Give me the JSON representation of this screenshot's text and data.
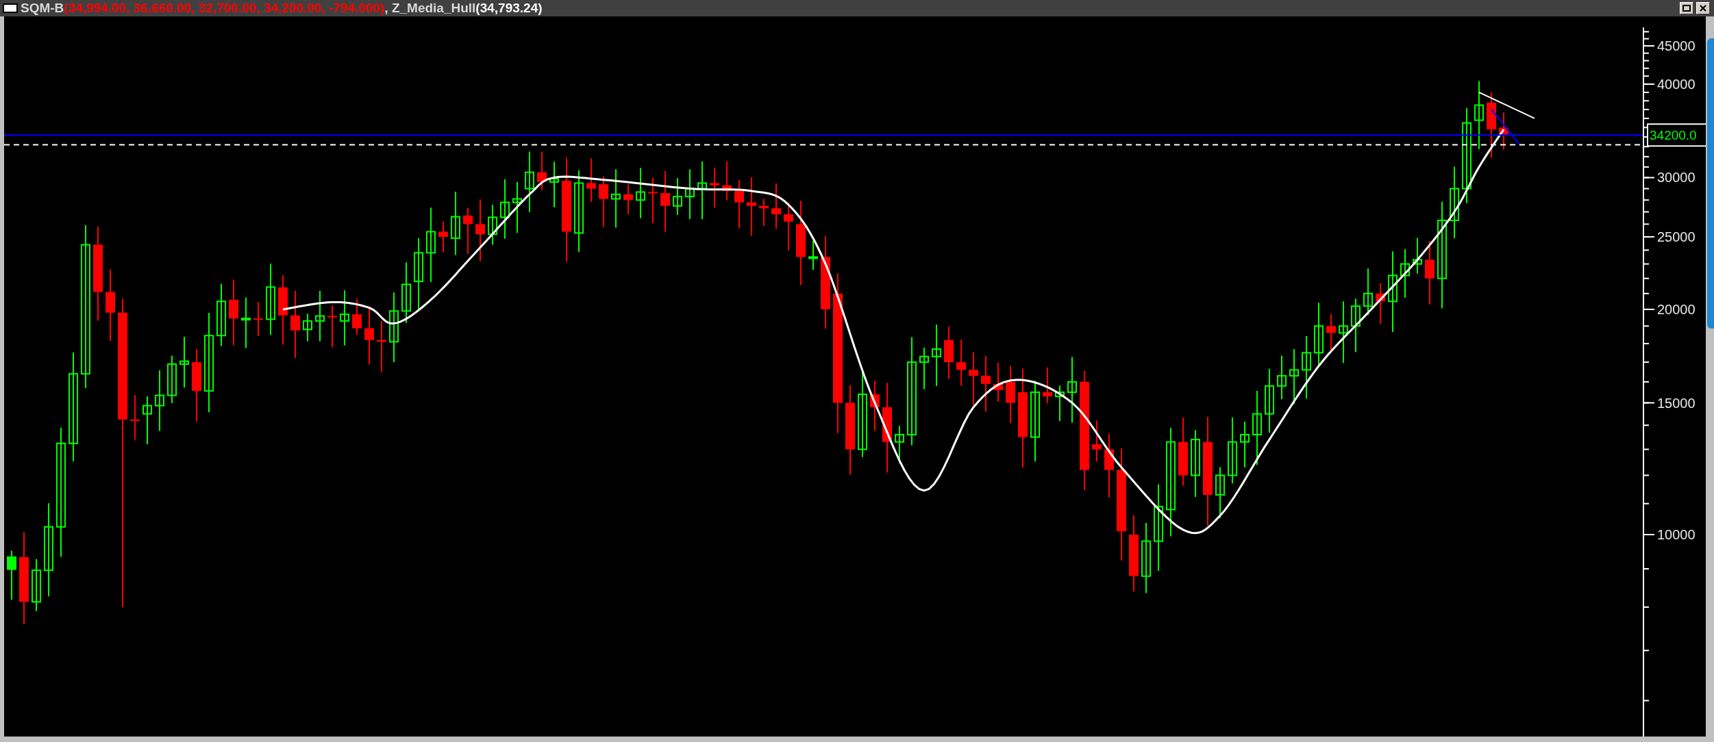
{
  "title_bar": {
    "symbol": "SQM-B",
    "quote": "(34,994.00, 36,660.00, 32,700.00, 34,200.00, -794.000)",
    "indicator": ", Z_Media_Hull",
    "indicator_value": "(34,793.24)"
  },
  "price_axis": {
    "ticks": [
      "45000",
      "40000",
      "30000",
      "25000",
      "20000",
      "15000",
      "10000"
    ],
    "last_price": "34200.0"
  }
}
